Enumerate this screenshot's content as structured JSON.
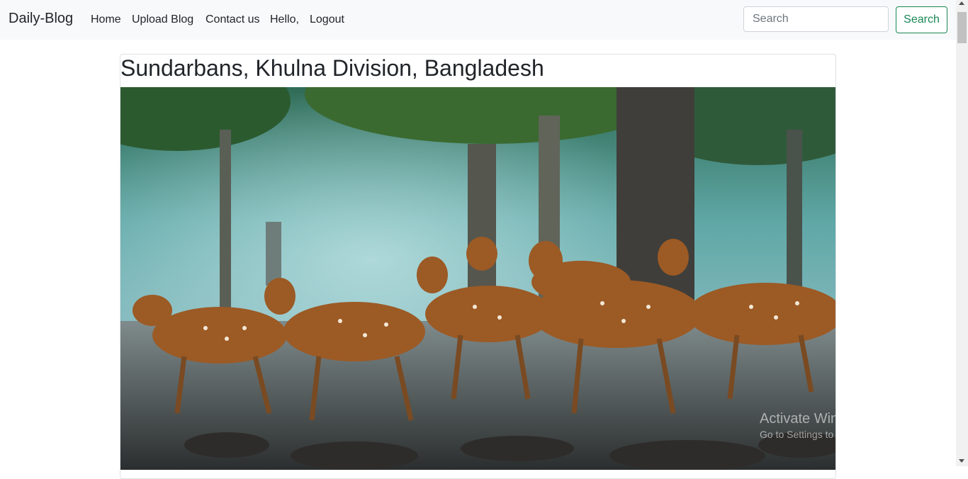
{
  "navbar": {
    "brand": "Daily-Blog",
    "links": [
      "Home",
      "Upload Blog",
      "Contact us",
      "Hello,",
      "Logout"
    ],
    "search_placeholder": "Search",
    "search_button": "Search"
  },
  "post": {
    "title": "Sundarbans, Khulna Division, Bangladesh",
    "image_subject": "spotted deer herd in mangrove forest"
  },
  "watermark": {
    "line1": "Activate Windows",
    "line2": "Go to Settings to activate Windows."
  },
  "colors": {
    "navbar_bg": "#f8f9fa",
    "accent_green": "#198754"
  }
}
